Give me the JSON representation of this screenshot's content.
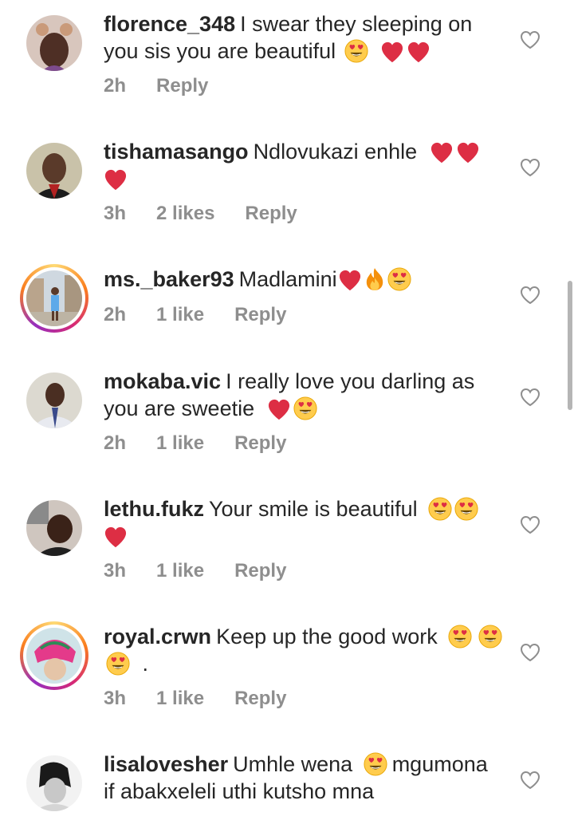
{
  "comments": [
    {
      "username": "florence_348",
      "text": "I swear they sleeping on you sis you are beautiful",
      "time": "2h",
      "likes": "",
      "reply": "Reply",
      "emoji": [
        "heart-eyes",
        "red-heart",
        "red-heart"
      ]
    },
    {
      "username": "tishamasango",
      "text": "Ndlovukazi enhle",
      "time": "3h",
      "likes": "2 likes",
      "reply": "Reply",
      "emoji": [
        "red-heart",
        "red-heart",
        "red-heart"
      ]
    },
    {
      "username": "ms._baker93",
      "text": "Madlamini",
      "time": "2h",
      "likes": "1 like",
      "reply": "Reply",
      "emoji": [
        "red-heart",
        "fire",
        "heart-eyes"
      ]
    },
    {
      "username": "mokaba.vic",
      "text": "I really love you darling as you are sweetie",
      "time": "2h",
      "likes": "1 like",
      "reply": "Reply",
      "emoji": [
        "red-heart",
        "heart-eyes"
      ]
    },
    {
      "username": "lethu.fukz",
      "text": "Your smile is beautiful",
      "time": "3h",
      "likes": "1 like",
      "reply": "Reply",
      "emoji": [
        "heart-eyes",
        "heart-eyes",
        "red-heart"
      ]
    },
    {
      "username": "royal.crwn",
      "text": "Keep up the good work",
      "time": "3h",
      "likes": "1 like",
      "reply": "Reply",
      "emoji": [
        "heart-eyes",
        "heart-eyes",
        "heart-eyes"
      ],
      "suffix": "."
    },
    {
      "username": "lisalovesher",
      "text": "Umhle wena",
      "text2": "mgumona if abakxeleli uthi kutsho mna",
      "time": "",
      "likes": "",
      "reply": "",
      "emoji": [
        "heart-eyes"
      ]
    }
  ]
}
